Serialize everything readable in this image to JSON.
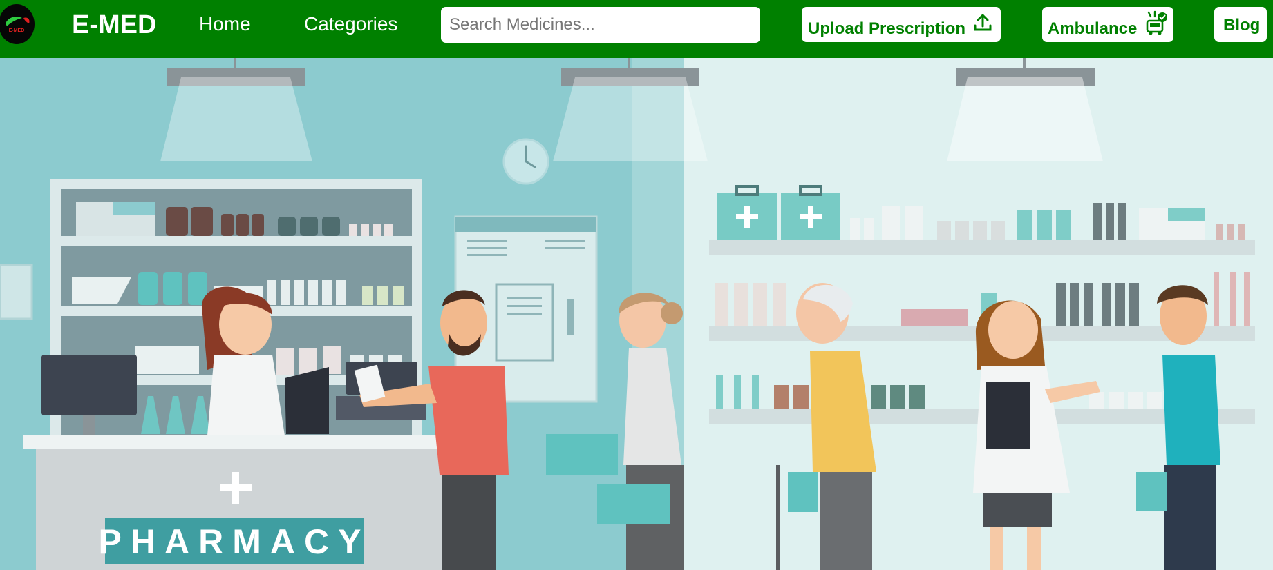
{
  "navbar": {
    "logo_text": "E-MED",
    "brand": "E-MED",
    "links": [
      {
        "label": "Home"
      },
      {
        "label": "Categories"
      }
    ],
    "search": {
      "placeholder": "Search Medicines...",
      "value": ""
    },
    "upload_button": {
      "label": "Upload Prescription",
      "icon": "upload-icon"
    },
    "ambulance_button": {
      "label": "Ambulance",
      "icon": "ambulance-icon"
    },
    "blog_button": {
      "label": "Blog"
    }
  },
  "hero": {
    "sign_text": "PHARMACY",
    "colors": {
      "nav": "#008000",
      "wall": "#8ccbcf",
      "wall_light": "#dff1f0",
      "accent": "#4cb6b4"
    }
  }
}
